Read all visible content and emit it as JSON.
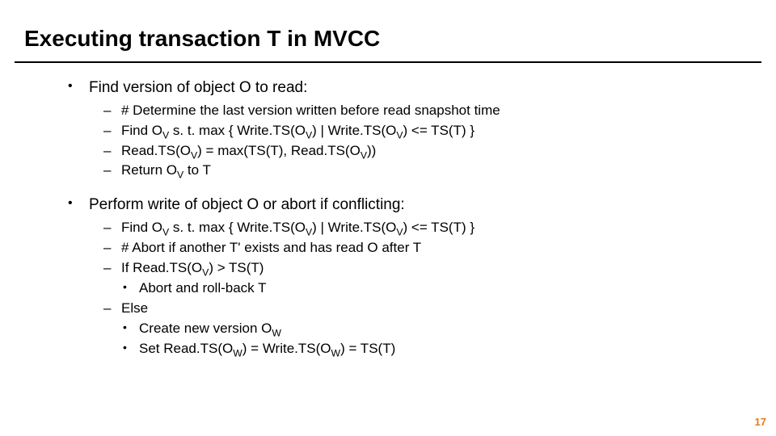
{
  "title": "Executing transaction T in MVCC",
  "section1": {
    "heading": "Find version of object O to read:",
    "items": [
      "# Determine the last version written before read snapshot time",
      "Find O<sub>V</sub>  s. t.  max { Write.TS(O<sub>V</sub>) | Write.TS(O<sub>V</sub>) <= TS(T) }",
      "Read.TS(O<sub>V</sub>) = max(TS(T), Read.TS(O<sub>V</sub>))",
      "Return O<sub>V</sub> to T"
    ]
  },
  "section2": {
    "heading": "Perform write of object O or abort if conflicting:",
    "items": [
      {
        "text": "Find  O<sub>V</sub>  s. t.  max { Write.TS(O<sub>V</sub>) | Write.TS(O<sub>V</sub>) <= TS(T) }"
      },
      {
        "text": "# Abort if another T' exists and has read O after T"
      },
      {
        "text": "If  Read.TS(O<sub>V</sub>) > TS(T)",
        "children": [
          "Abort and roll-back T"
        ]
      },
      {
        "text": "Else",
        "children": [
          "Create new version O<sub>W</sub>",
          "Set Read.TS(O<sub>W</sub>) = Write.TS(O<sub>W</sub>) = TS(T)"
        ]
      }
    ]
  },
  "page_number": "17"
}
